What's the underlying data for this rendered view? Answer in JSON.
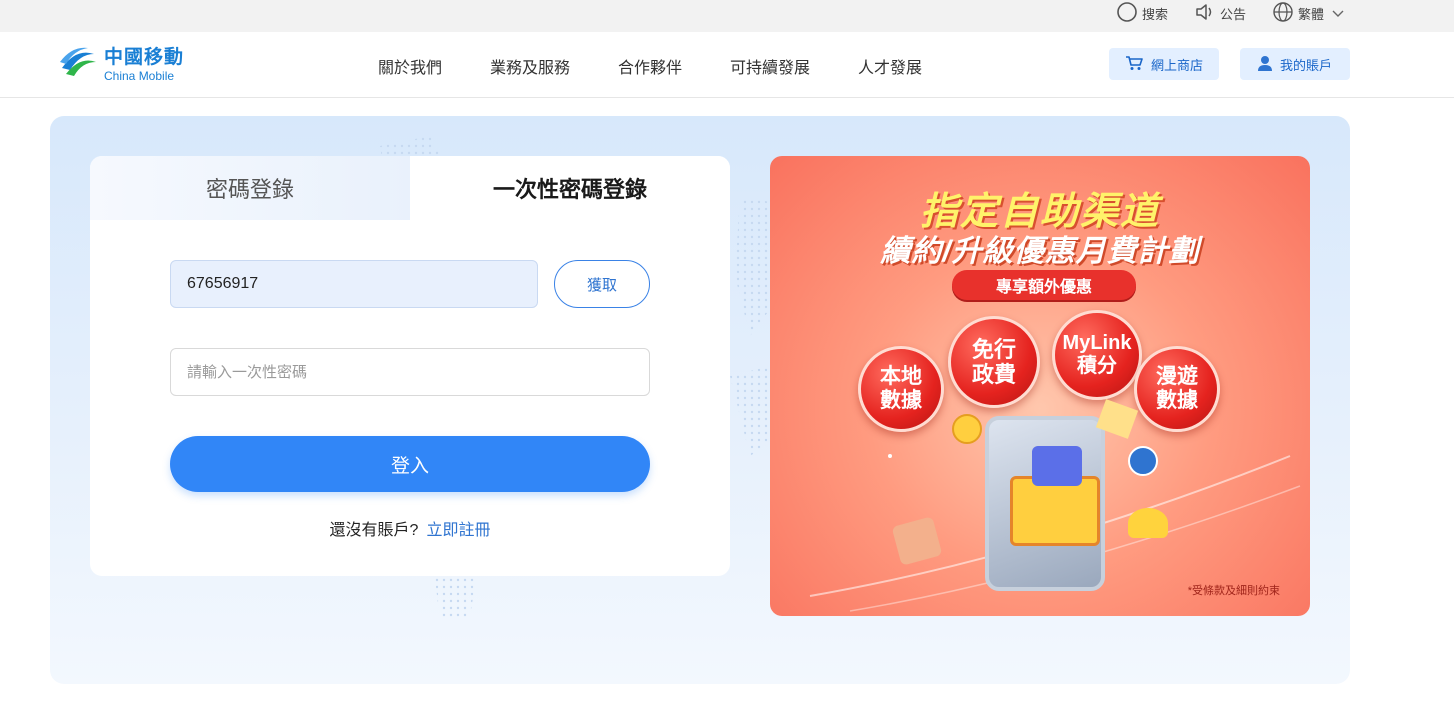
{
  "utility_bar": {
    "search": "搜索",
    "notice": "公告",
    "language": "繁體"
  },
  "header": {
    "logo_cn": "中國移動",
    "logo_en": "China Mobile",
    "nav": [
      "關於我們",
      "業務及服務",
      "合作夥伴",
      "可持續發展",
      "人才發展"
    ],
    "shop_button": "網上商店",
    "account_button": "我的賬戶"
  },
  "login": {
    "tab_password": "密碼登錄",
    "tab_otp": "一次性密碼登錄",
    "active_tab": "一次性密碼登錄",
    "phone_value": "67656917",
    "get_button": "獲取",
    "otp_placeholder": "請輸入一次性密碼",
    "otp_value": "",
    "login_button": "登入",
    "no_account_text": "還沒有賬戶?",
    "register_link": "立即註冊"
  },
  "banner": {
    "title_line1": "指定自助渠道",
    "title_line2": "續約/升級優惠月費計劃",
    "pill": "專享額外優惠",
    "bubbles": [
      [
        "本地",
        "數據"
      ],
      [
        "免行",
        "政費"
      ],
      [
        "MyLink",
        "積分"
      ],
      [
        "漫遊",
        "數據"
      ]
    ],
    "footnote": "*受條款及細則約束"
  },
  "colors": {
    "brand_blue": "#1a7fd4",
    "primary_button": "#3186f7",
    "banner_red": "#e5231f",
    "banner_yellow": "#fff36a"
  },
  "icons": {
    "search": "search-icon",
    "notice": "speaker-icon",
    "language": "globe-icon",
    "dropdown": "chevron-down-icon",
    "shop": "cart-icon",
    "account": "user-icon"
  }
}
